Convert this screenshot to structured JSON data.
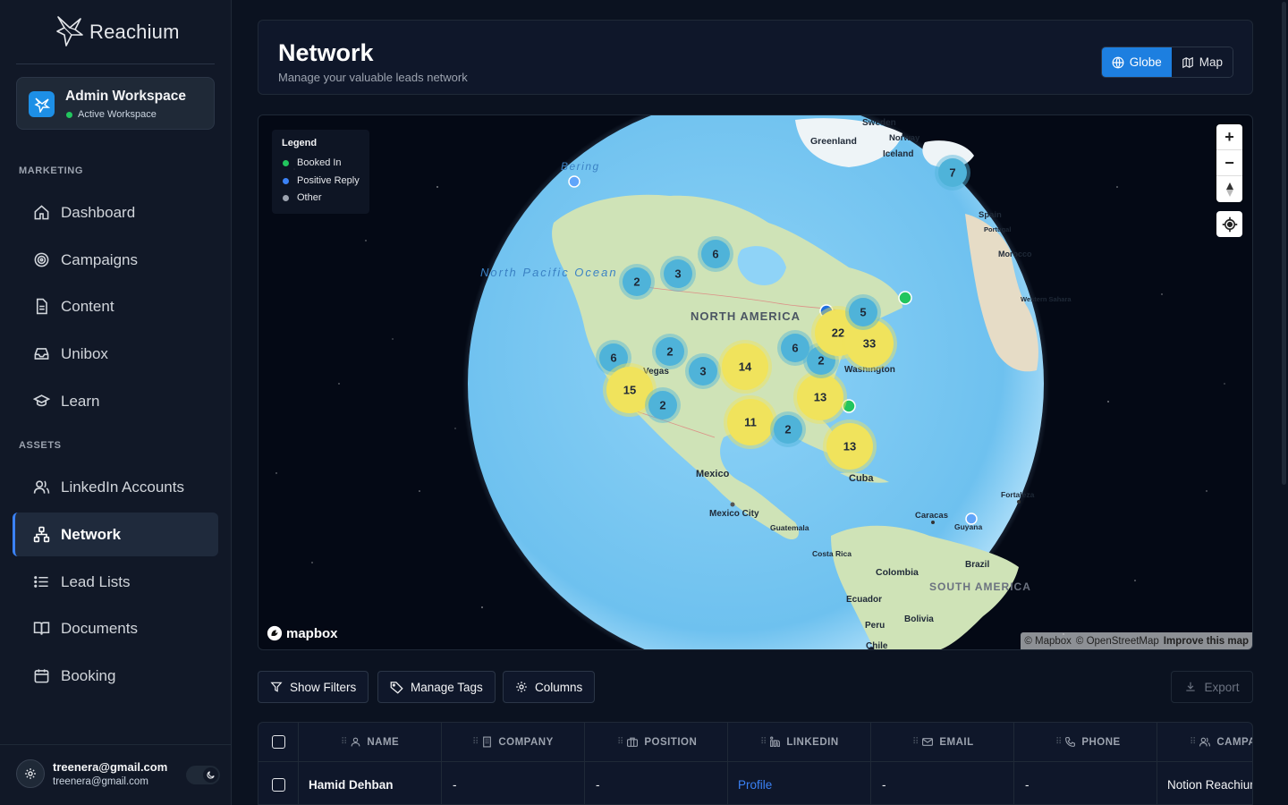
{
  "app": {
    "name": "Reachium"
  },
  "workspace": {
    "title": "Admin Workspace",
    "status": "Active Workspace"
  },
  "sidebar": {
    "sections": [
      {
        "label": "MARKETING",
        "items": [
          {
            "label": "Dashboard",
            "icon": "home-icon"
          },
          {
            "label": "Campaigns",
            "icon": "target-icon"
          },
          {
            "label": "Content",
            "icon": "document-icon"
          },
          {
            "label": "Unibox",
            "icon": "inbox-icon"
          },
          {
            "label": "Learn",
            "icon": "graduation-cap-icon"
          }
        ]
      },
      {
        "label": "ASSETS",
        "items": [
          {
            "label": "LinkedIn Accounts",
            "icon": "users-icon"
          },
          {
            "label": "Network",
            "icon": "network-icon",
            "active": true
          },
          {
            "label": "Lead Lists",
            "icon": "list-icon"
          },
          {
            "label": "Documents",
            "icon": "book-icon"
          },
          {
            "label": "Booking",
            "icon": "calendar-icon"
          }
        ]
      }
    ]
  },
  "user": {
    "name": "treenera@gmail.com",
    "email": "treenera@gmail.com"
  },
  "header": {
    "title": "Network",
    "subtitle": "Manage your valuable leads network",
    "views": [
      {
        "label": "Globe",
        "active": true
      },
      {
        "label": "Map",
        "active": false
      }
    ]
  },
  "map": {
    "legend": {
      "title": "Legend",
      "items": [
        {
          "label": "Booked In",
          "color": "#22c55e"
        },
        {
          "label": "Positive Reply",
          "color": "#3b82f6"
        },
        {
          "label": "Other",
          "color": "#9ca3af"
        }
      ]
    },
    "labels": {
      "north_america": "NORTH AMERICA",
      "south_america": "SOUTH AMERICA",
      "north_pacific": "North Pacific Ocean",
      "bering": "Bering",
      "greenland": "Greenland",
      "sweden": "Sweden",
      "norway": "Norway",
      "iceland": "Iceland",
      "spain": "Spain",
      "portugal": "Portugal",
      "morocco": "Morocco",
      "western_sahara": "Western Sahara",
      "mexico": "Mexico",
      "mexico_city": "Mexico City",
      "guatemala": "Guatemala",
      "costa_rica": "Costa Rica",
      "cuba": "Cuba",
      "colombia": "Colombia",
      "ecuador": "Ecuador",
      "peru": "Peru",
      "bolivia": "Bolivia",
      "brazil": "Brazil",
      "chile": "Chile",
      "caracas": "Caracas",
      "guyana": "Guyana",
      "fortaleza": "Fortaleza",
      "washington": "Washington",
      "las_vegas": "Vegas"
    },
    "clusters": [
      {
        "count": "6",
        "kind": "blue"
      },
      {
        "count": "3",
        "kind": "blue"
      },
      {
        "count": "2",
        "kind": "blue"
      },
      {
        "count": "2",
        "kind": "blue"
      },
      {
        "count": "6",
        "kind": "blue"
      },
      {
        "count": "3",
        "kind": "blue"
      },
      {
        "count": "15",
        "kind": "yellow"
      },
      {
        "count": "2",
        "kind": "blue"
      },
      {
        "count": "14",
        "kind": "yellow"
      },
      {
        "count": "11",
        "kind": "yellow"
      },
      {
        "count": "2",
        "kind": "blue"
      },
      {
        "count": "13",
        "kind": "yellow"
      },
      {
        "count": "13",
        "kind": "yellow"
      },
      {
        "count": "6",
        "kind": "blue"
      },
      {
        "count": "2",
        "kind": "blue"
      },
      {
        "count": "22",
        "kind": "yellow"
      },
      {
        "count": "33",
        "kind": "yellow"
      },
      {
        "count": "5",
        "kind": "blue"
      },
      {
        "count": "7",
        "kind": "blue"
      }
    ],
    "zoom_in": "+",
    "zoom_out": "−",
    "provider": "mapbox",
    "attribution": {
      "mapbox": "© Mapbox",
      "osm": "© OpenStreetMap",
      "improve": "Improve this map"
    }
  },
  "toolbar": {
    "show_filters": "Show Filters",
    "manage_tags": "Manage Tags",
    "columns": "Columns",
    "export": "Export"
  },
  "table": {
    "columns": [
      "NAME",
      "COMPANY",
      "POSITION",
      "LINKEDIN",
      "EMAIL",
      "PHONE",
      "CAMPA"
    ],
    "rows": [
      {
        "name": "Hamid Dehban",
        "company": "-",
        "position": "-",
        "linkedin": "Profile",
        "email": "-",
        "phone": "-",
        "campaign": "Notion Reachium"
      }
    ]
  }
}
